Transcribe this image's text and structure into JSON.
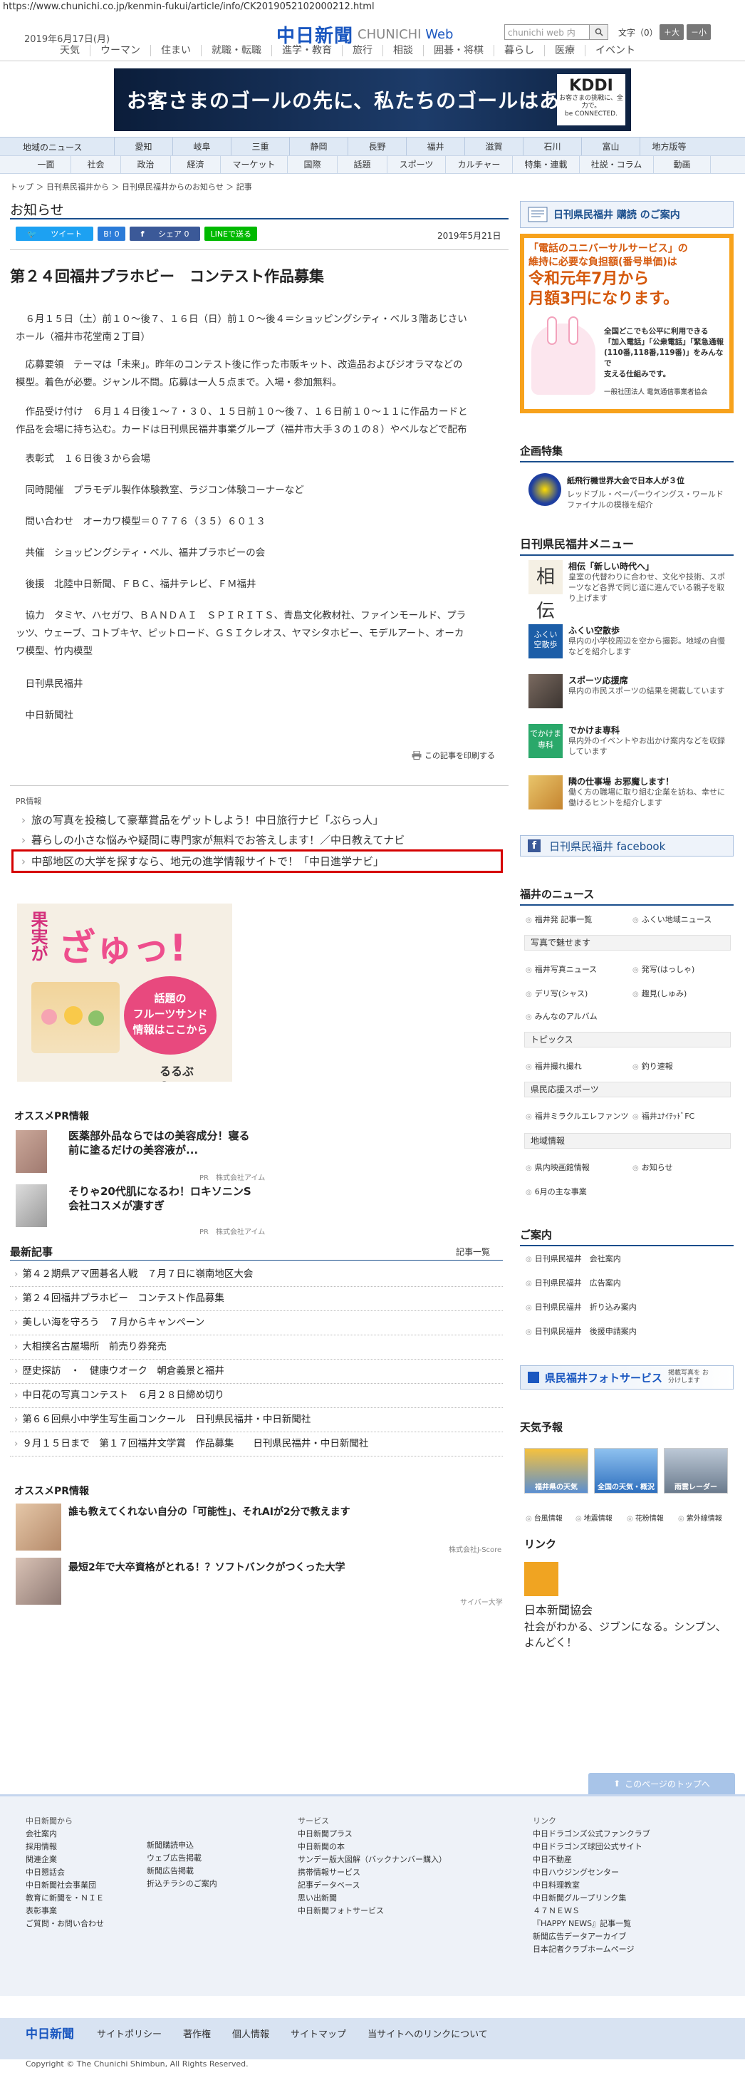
{
  "url": "https://www.chunichi.co.jp/kenmin-fukui/article/info/CK2019052102000212.html",
  "header": {
    "date": "2019年6月17日(月)",
    "logo_kanji": "中日新聞",
    "logo_en1": "CHUNICHI",
    "logo_en2": "Web",
    "search_placeholder": "chunichi web 内",
    "font_label": "文字（0）",
    "font_big": "＋大",
    "font_small": "－小",
    "nav": [
      "天気",
      "ウーマン",
      "住まい",
      "就職・転職",
      "進学・教育",
      "旅行",
      "相談",
      "囲碁・将棋",
      "暮らし",
      "医療",
      "イベント"
    ]
  },
  "ad": {
    "text": "お客さまのゴールの先に、私たちのゴールはある。",
    "brand": "KDDI",
    "brand_sub": "お客さまの挑戦に、全力で。",
    "brand_sub2": "be CONNECTED."
  },
  "region_nav": {
    "label": "地域のニュース",
    "items": [
      "愛知",
      "岐阜",
      "三重",
      "静岡",
      "長野",
      "福井",
      "滋賀",
      "石川",
      "富山",
      "地方版等"
    ]
  },
  "cat_nav": [
    "一面",
    "社会",
    "政治",
    "経済",
    "マーケット",
    "国際",
    "話題",
    "スポーツ",
    "カルチャー",
    "特集・連載",
    "社説・コラム",
    "動画"
  ],
  "breadcrumb": "トップ ＞ 日刊県民福井から ＞ 日刊県民福井からのお知らせ ＞ 記事",
  "section": "お知らせ",
  "sns": {
    "tweet": "ツイート",
    "hatena": "B! 0",
    "share": "シェア 0",
    "line": "LINEで送る"
  },
  "pubdate": "2019年5月21日",
  "article": {
    "title": "第２４回福井プラホビー　コンテスト作品募集",
    "p1a": "　６月１５日（土）前１０～後７、１６日（日）前１０～後４＝ショッピングシティ・ベル３階あじさい",
    "p1b": "ホール（福井市花堂南２丁目）",
    "p2a": "　応募要領　テーマは「未来」。昨年のコンテスト後に作った市販キット、改造品およびジオラマなどの",
    "p2b": "模型。着色が必要。ジャンル不問。応募は一人５点まで。入場・参加無料。",
    "p3a": "　作品受け付け　６月１４日後１～７・３０、１５日前１０～後７、１６日前１０～１１に作品カードと",
    "p3b": "作品を会場に持ち込む。カードは日刊県民福井事業グループ（福井市大手３の１の８）やベルなどで配布",
    "p4": "　表彰式　１６日後３から会場",
    "p5": "　同時開催　プラモデル製作体験教室、ラジコン体験コーナーなど",
    "p6": "　問い合わせ　オーカワ模型＝０７７６（３５）６０１３",
    "p7": "　共催　ショッピングシティ・ベル、福井プラホビーの会",
    "p8": "　後援　北陸中日新聞、ＦＢＣ、福井テレビ、ＦＭ福井",
    "p9a": "　協力　タミヤ、ハセガワ、ＢＡＮＤＡＩ　ＳＰＩＲＩＴＳ、青島文化教材社、ファインモールド、プラ",
    "p9b": "ッツ、ウェーブ、コトブキヤ、ピットロード、ＧＳＩクレオス、ヤマシタホビー、モデルアート、オーカ",
    "p9c": "ワ模型、竹内模型",
    "p10": "　日刊県民福井",
    "p11": "　中日新聞社",
    "print": "この記事を印刷する"
  },
  "pr": {
    "label": "PR情報",
    "links": [
      "旅の写真を投稿して豪華賞品をゲットしよう！中日旅行ナビ「ぶらっ人」",
      "暮らしの小さな悩みや疑問に専門家が無料でお答えします！／中日教えてナビ",
      "中部地区の大学を探すなら、地元の進学情報サイトで！「中日進学ナビ」"
    ]
  },
  "sweets_ad": {
    "line1": "果実が",
    "line2": "ざゅっ!",
    "line3": "話題の",
    "line4": "フルーツサンド",
    "line5": "情報はここから",
    "brand": "るるぶ&more."
  },
  "osusume1": {
    "title": "オススメPR情報",
    "items": [
      {
        "text1": "医薬部外品ならではの美容成分！寝る",
        "text2": "前に塗るだけの美容液が...",
        "src": "PR　株式会社アイム"
      },
      {
        "text1": "そりゃ20代肌になるわ！ロキソニンS",
        "text2": "会社コスメが凄すぎ",
        "src": "PR　株式会社アイム"
      }
    ]
  },
  "latest": {
    "title": "最新記事",
    "more": "記事一覧",
    "items": [
      "第４２期県アマ囲碁名人戦　７月７日に嶺南地区大会",
      "第２４回福井プラホビー　コンテスト作品募集",
      "美しい海を守ろう　７月からキャンペーン",
      "大相撲名古屋場所　前売り券発売",
      "歴史探訪　・　健康ウオーク　朝倉義景と福井",
      "中日花の写真コンテスト　６月２８日締め切り",
      "第６６回県小中学生写生画コンクール　日刊県民福井・中日新聞社",
      "９月１５日まで　第１７回福井文学賞　作品募集　　日刊県民福井・中日新聞社"
    ]
  },
  "osusume2": {
    "title": "オススメPR情報",
    "items": [
      {
        "text": "誰も教えてくれない自分の「可能性」、それAIが2分で教えます",
        "src": "株式会社J-Score"
      },
      {
        "text": "最短2年で大卒資格がとれる！？ソフトバンクがつくった大学",
        "src": "サイバー大学"
      }
    ]
  },
  "sidebar": {
    "subscribe": "日刊県民福井 購読 のご案内",
    "uni_ad": {
      "l1": "「電話のユニバーサルサービス」の",
      "l2": "維持に必要な負担額(番号単価)は",
      "l3": "令和元年7月から",
      "l4": "月額3円になります。",
      "l5": "全国どこでも公平に利用できる",
      "l6": "「加入電話」「公衆電話」「緊急通報",
      "l7": "(110番,118番,119番)」をみんなで",
      "l8": "支える仕組みです。",
      "l9": "一般社団法人 電気通信事業者協会"
    },
    "kikaku": {
      "title": "企画特集",
      "name": "紙飛行機世界大会で日本人が３位",
      "desc": "レッドブル・ペーパーウイングス・ワールドファイナルの模様を紹介"
    },
    "menu": {
      "title": "日刊県民福井メニュー",
      "items": [
        {
          "t": "相伝「新しい時代へ」",
          "d": "皇室の代替わりに合わせ、文化や技術、スポーツなど各界で同じ道に進んでいる親子を取り上げます"
        },
        {
          "t": "ふくい空散歩",
          "d": "県内の小学校周辺を空から撮影。地域の自慢などを紹介します"
        },
        {
          "t": "スポーツ応援席",
          "d": "県内の市民スポーツの結果を掲載しています"
        },
        {
          "t": "でかけま専科",
          "d": "県内外のイベントやお出かけ案内などを収録しています"
        },
        {
          "t": "隣の仕事場 お邪魔します！",
          "d": "働く方の職場に取り組む企業を訪ね、幸せに働けるヒントを紹介します"
        }
      ]
    },
    "facebook": "日刊県民福井 facebook",
    "news": {
      "title": "福井のニュース",
      "r1": [
        "福井発 記事一覧",
        "ふくい地域ニュース"
      ],
      "photo_head": "写真で魅せます",
      "r2": [
        "福井写真ニュース",
        "発写(はっしゃ)"
      ],
      "r3": [
        "デリ写(シャス)",
        "趣見(しゅみ)"
      ],
      "r4": [
        "みんなのアルバム"
      ],
      "topics_head": "トピックス",
      "r5": [
        "福井撮れ撮れ",
        "釣り速報"
      ],
      "sports_head": "県民応援スポーツ",
      "r6": [
        "福井ミラクルエレファンツ",
        "福井ﾕﾅｲﾃｯﾄﾞFC"
      ],
      "local_head": "地域情報",
      "r7": [
        "県内映画館情報",
        "お知らせ"
      ],
      "r8": [
        "6月の主な事業"
      ]
    },
    "goannai": {
      "title": "ご案内",
      "items": [
        "日刊県民福井　会社案内",
        "日刊県民福井　広告案内",
        "日刊県民福井　折り込み案内",
        "日刊県民福井　後援申請案内"
      ]
    },
    "photo_service": {
      "text": "県民福井フォトサービス",
      "sub": "掲載写真を お分けします"
    },
    "weather": {
      "title": "天気予報",
      "boxes": [
        "福井県の天気",
        "全国の天気・概況",
        "雨雲レーダー"
      ],
      "links": [
        "台風情報",
        "地震情報",
        "花粉情報",
        "紫外線情報"
      ]
    },
    "link": {
      "title": "リンク",
      "name": "日本新聞協会",
      "desc": "社会がわかる、ジブンになる。シンブン、よんどく！"
    }
  },
  "footer": {
    "totop": "このページのトップへ",
    "col1": {
      "head": "中日新聞から",
      "items": [
        "会社案内",
        "採用情報",
        "関連企業",
        "中日懇話会",
        "中日新聞社会事業団",
        "教育に新聞を・ＮＩＥ",
        "表彰事業",
        "ご質問・お問い合わせ"
      ]
    },
    "col2": {
      "items": [
        "新聞購読申込",
        "ウェブ広告掲載",
        "新聞広告掲載",
        "折込チラシのご案内"
      ]
    },
    "col3": {
      "head": "サービス",
      "items": [
        "中日新聞プラス",
        "中日新聞の本",
        "サンデー版大図解（バックナンバー購入）",
        "携帯情報サービス",
        "記事データベース",
        "思い出新聞",
        "中日新聞フォトサービス"
      ]
    },
    "col4": {
      "head": "リンク",
      "items": [
        "中日ドラゴンズ公式ファンクラブ",
        "中日ドラゴンズ球団公式サイト",
        "中日不動産",
        "中日ハウジングセンター",
        "中日料理教室",
        "中日新聞グループリンク集",
        "４７ＮＥＷＳ",
        "『HAPPY NEWS』記事一覧",
        "新聞広告データアーカイブ",
        "日本記者クラブホームページ"
      ]
    },
    "bar_logo": "中日新聞",
    "bar_links": [
      "サイトポリシー",
      "著作権",
      "個人情報",
      "サイトマップ",
      "当サイトへのリンクについて"
    ],
    "copyright": "Copyright © The Chunichi Shimbun, All Rights Reserved."
  }
}
